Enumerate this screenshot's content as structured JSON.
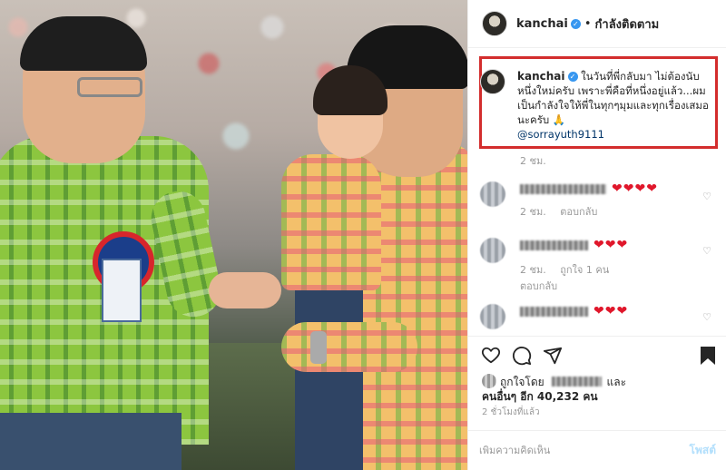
{
  "post": {
    "username": "kanchai",
    "follow_state": "กำลังติดตาม",
    "caption": "ในวันที่พี่กลับมา ไม่ต้องนับหนึ่งใหม่ครับ เพราะพี่คือที่หนึ่งอยู่แล้ว...ผมเป็นกำลังใจให้พี่ในทุกๆมุมและทุกเรื่องเสมอนะครับ 🙏",
    "mention": "@sorrayuth9111",
    "caption_time": "2 ชม.",
    "icons": {
      "verified": "verified-badge-icon",
      "like": "heart-outline-icon",
      "comment": "comment-bubble-icon",
      "share": "paper-plane-icon",
      "save": "bookmark-icon"
    }
  },
  "comments": [
    {
      "hearts": "❤❤❤❤",
      "time": "2 ชม.",
      "reply": "ตอบกลับ",
      "likes": ""
    },
    {
      "hearts": "❤❤❤",
      "time": "2 ชม.",
      "likes": "ถูกใจ 1 คน",
      "reply": "ตอบกลับ"
    },
    {
      "hearts": "❤❤❤",
      "time": "",
      "likes": "",
      "reply": ""
    }
  ],
  "likes": {
    "prefix": "ถูกใจโดย",
    "and": "และ",
    "others": "คนอื่นๆ อีก 40,232 คน"
  },
  "time_ago": "2 ชั่วโมงที่แล้ว",
  "add_comment": {
    "placeholder": "เพิ่มความคิดเห็น",
    "post_label": "โพสต์"
  },
  "colors": {
    "highlight_border": "#d32d2d",
    "heart": "#e0172b",
    "link": "#003569",
    "verified": "#3897f0"
  }
}
